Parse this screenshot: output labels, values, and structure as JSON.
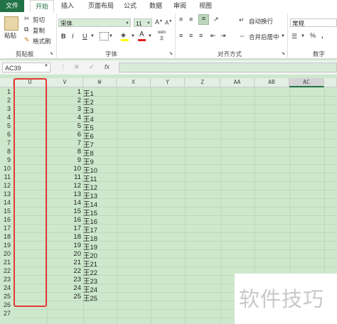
{
  "tabs": [
    "文件",
    "开始",
    "插入",
    "页面布局",
    "公式",
    "数据",
    "审阅",
    "视图"
  ],
  "clipboard": {
    "paste": "粘贴",
    "cut": "剪切",
    "copy": "复制",
    "format_painter": "格式刷",
    "group": "剪贴板"
  },
  "font": {
    "name": "宋体",
    "size": "11",
    "group": "字体",
    "increase": "A",
    "decrease": "A",
    "bold": "B",
    "italic": "I",
    "underline": "U",
    "font_color_letter": "A",
    "phonetic": "wén"
  },
  "alignment": {
    "wrap": "自动换行",
    "merge": "合并后居中",
    "group": "对齐方式"
  },
  "number": {
    "format": "常规",
    "group": "数字",
    "percent": "%",
    "comma": ","
  },
  "formula_bar": {
    "name_box": "AC39",
    "cancel": "✕",
    "enter": "✓",
    "fx": "fx"
  },
  "columns": [
    "U",
    "V",
    "W",
    "X",
    "Y",
    "Z",
    "AA",
    "AB",
    "AC"
  ],
  "rows": [
    "1",
    "2",
    "3",
    "4",
    "5",
    "6",
    "7",
    "8",
    "9",
    "10",
    "11",
    "12",
    "13",
    "14",
    "15",
    "16",
    "17",
    "18",
    "19",
    "20",
    "21",
    "22",
    "23",
    "24",
    "25",
    "26",
    "27"
  ],
  "v_values": [
    "1",
    "2",
    "3",
    "4",
    "5",
    "6",
    "7",
    "8",
    "9",
    "10",
    "11",
    "12",
    "13",
    "14",
    "15",
    "16",
    "17",
    "18",
    "19",
    "20",
    "21",
    "22",
    "23",
    "24",
    "25"
  ],
  "w_values": [
    "王1",
    "王2",
    "王3",
    "王4",
    "王5",
    "王6",
    "王7",
    "王8",
    "王9",
    "王10",
    "王11",
    "王12",
    "王13",
    "王14",
    "王15",
    "王16",
    "王17",
    "王18",
    "王19",
    "王20",
    "王21",
    "王22",
    "王23",
    "王24",
    "王25"
  ],
  "watermark": "软件技巧",
  "colors": {
    "accent": "#217346",
    "sheet_bg": "#cde8cd",
    "highlight": "#e53935"
  }
}
